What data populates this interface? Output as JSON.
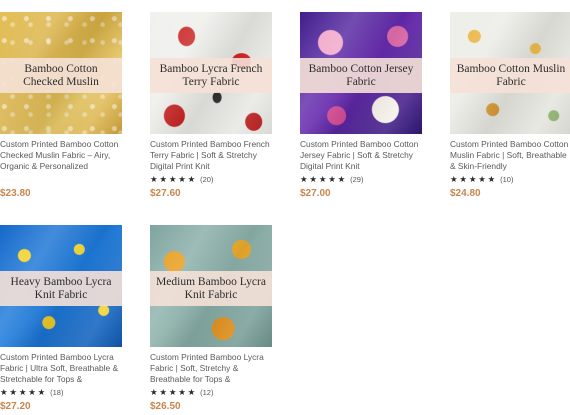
{
  "products": [
    {
      "image_label": "Bamboo Cotton Checked Muslin",
      "name": "Custom Printed Bamboo Cotton Checked Muslin Fabric – Airy, Organic & Personalized",
      "stars": "★★★★★",
      "review_count": "",
      "price": "$23.80",
      "pattern": "yellow-fabric"
    },
    {
      "image_label": "Bamboo Lycra French Terry Fabric",
      "name": "Custom Printed Bamboo French Terry Fabric | Soft & Stretchy Digital Print Knit",
      "stars": "★★★★★",
      "review_count": "(20)",
      "price": "$27.60",
      "pattern": "red-birds-fabric"
    },
    {
      "image_label": "Bamboo Cotton Jersey Fabric",
      "name": "Custom Printed Bamboo Cotton Jersey Fabric | Soft & Stretchy Digital Print Knit",
      "stars": "★★★★★",
      "review_count": "(29)",
      "price": "$27.00",
      "pattern": "purple-floral-fabric"
    },
    {
      "image_label": "Bamboo Cotton Muslin Fabric",
      "name": "Custom Printed Bamboo Cotton Muslin Fabric | Soft, Breathable & Skin-Friendly",
      "stars": "★★★★★",
      "review_count": "(10)",
      "price": "$24.80",
      "pattern": "animal-print-fabric"
    },
    {
      "image_label": "Heavy Bamboo Lycra Knit Fabric",
      "name": "Custom Printed Bamboo Lycra Fabric | Ultra Soft, Breathable & Stretchable for Tops &",
      "stars": "★★★★★",
      "review_count": "(18)",
      "price": "$27.20",
      "pattern": "blue-yellow-fabric"
    },
    {
      "image_label": "Medium Bamboo Lycra Knit Fabric",
      "name": "Custom Printed Bamboo Lycra Fabric | Soft, Stretchy & Breathable for Tops &",
      "stars": "★★★★★",
      "review_count": "(12)",
      "price": "$26.50",
      "pattern": "sunflower-fabric"
    }
  ],
  "colors": {
    "price": "#c8864f",
    "banner_bg": "#f5e1d7",
    "text": "#5a5a5a"
  }
}
